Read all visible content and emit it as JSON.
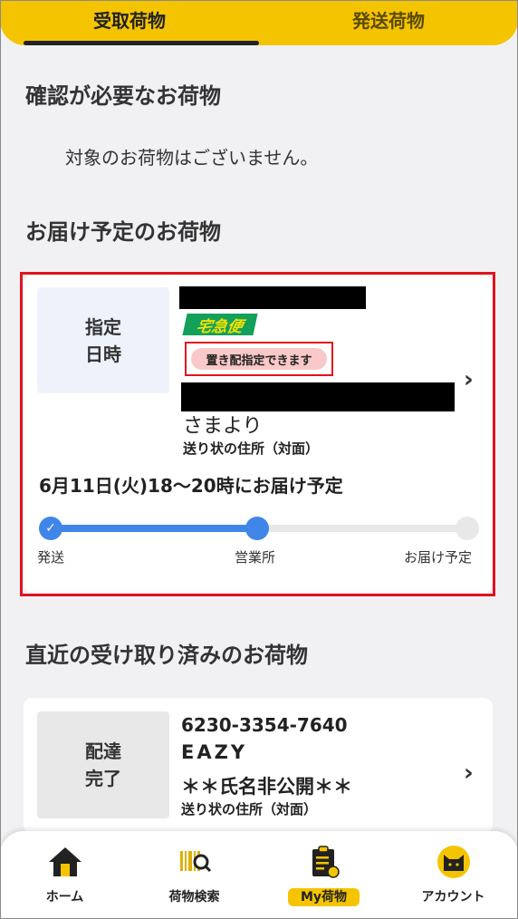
{
  "tabs": [
    {
      "label": "受取荷物",
      "active": true
    },
    {
      "label": "発送荷物",
      "active": false
    }
  ],
  "sections": {
    "needs_confirmation_title": "確認が必要なお荷物",
    "needs_confirmation_empty": "対象のお荷物はございません。",
    "scheduled_title": "お届け予定のお荷物",
    "recent_received_title": "直近の受け取り済みのお荷物"
  },
  "scheduled_card": {
    "status": "指定\n日時",
    "service": "宅急便",
    "okihai_badge": "置き配指定できます",
    "sender_suffix": "さまより",
    "address_type": "送り状の住所（対面）",
    "delivery_schedule": "6月11日(火)18～20時にお届け予定",
    "steps": [
      "発送",
      "営業所",
      "お届け予定"
    ],
    "progress_fraction": 0.5
  },
  "received_card": {
    "status": "配達\n完了",
    "tracking_number": "6230-3354-7640",
    "brand": "EAZY",
    "recipient": "＊＊氏名非公開＊＊",
    "address_type": "送り状の住所（対面）"
  },
  "bottom_nav": [
    {
      "label": "ホーム",
      "icon": "home-icon"
    },
    {
      "label": "荷物検索",
      "icon": "barcode-search-icon"
    },
    {
      "label": "My荷物",
      "icon": "my-package-icon",
      "active": true
    },
    {
      "label": "アカウント",
      "icon": "cat-account-icon"
    }
  ],
  "colors": {
    "brand_yellow": "#f5c400",
    "progress_blue": "#3f86e8",
    "highlight_red": "#e0141e"
  }
}
